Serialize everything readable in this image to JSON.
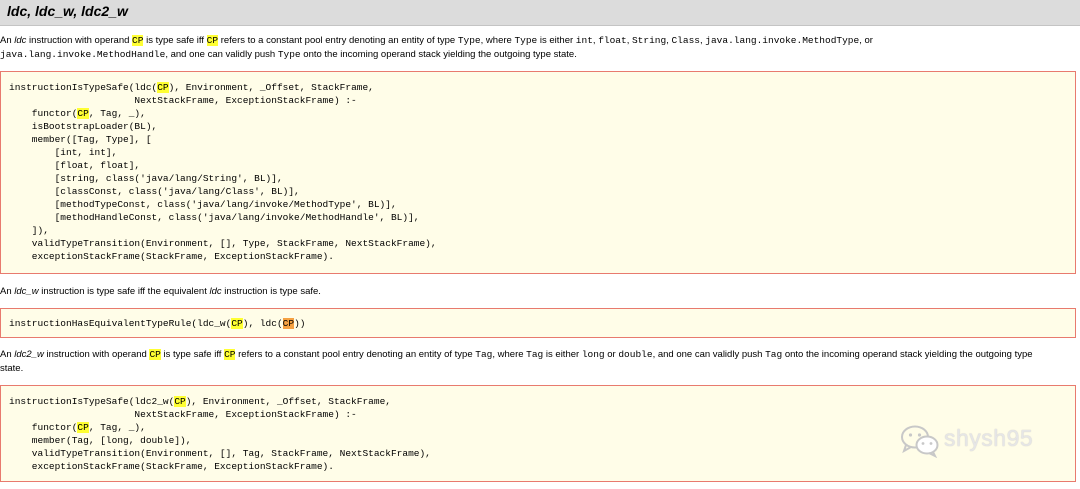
{
  "section": {
    "title": "ldc, ldc_w, ldc2_w"
  },
  "para1": {
    "t1": "An ",
    "ldc": "ldc",
    "t2": " instruction with operand ",
    "cp1": "CP",
    "t3": " is type safe iff ",
    "cp2": "CP",
    "t4": " refers to a constant pool entry denoting an entity of type ",
    "c_type": "Type",
    "t5": ", where ",
    "c_type2": "Type",
    "t6": " is either ",
    "c_int": "int",
    "t7": ", ",
    "c_float": "float",
    "t8": ", ",
    "c_string": "String",
    "t9": ", ",
    "c_class": "Class",
    "t10": ", ",
    "c_mt": "java.lang.invoke.MethodType",
    "t11": ", or",
    "c_mh": "java.lang.invoke.MethodHandle",
    "t12": ", and one can validly push ",
    "c_type3": "Type",
    "t13": " onto the incoming operand stack yielding the outgoing type state."
  },
  "code1": {
    "l1a": "instructionIsTypeSafe(ldc(",
    "l1cp": "CP",
    "l1b": "), Environment, _Offset, StackFrame,",
    "l2": "                      NextStackFrame, ExceptionStackFrame) :-",
    "l3a": "    functor(",
    "l3cp": "CP",
    "l3b": ", Tag, _),",
    "l4": "    isBootstrapLoader(BL),",
    "l5": "    member([Tag, Type], [",
    "l6": "        [int, int],",
    "l7": "        [float, float],",
    "l8": "        [string, class('java/lang/String', BL)],",
    "l9": "        [classConst, class('java/lang/Class', BL)],",
    "l10": "        [methodTypeConst, class('java/lang/invoke/MethodType', BL)],",
    "l11": "        [methodHandleConst, class('java/lang/invoke/MethodHandle', BL)],",
    "l12": "    ]),",
    "l13": "    validTypeTransition(Environment, [], Type, StackFrame, NextStackFrame),",
    "l14": "    exceptionStackFrame(StackFrame, ExceptionStackFrame)."
  },
  "para2": {
    "t1": "An ",
    "ldcw": "ldc_w",
    "t2": " instruction is type safe iff the equivalent ",
    "ldc": "ldc",
    "t3": " instruction is type safe."
  },
  "code2": {
    "a": "instructionHasEquivalentTypeRule(ldc_w(",
    "cp1": "CP",
    "b": "), ldc(",
    "cp2": "CP",
    "c": "))"
  },
  "para3": {
    "t1": "An ",
    "ldc2w": "ldc2_w",
    "t2": " instruction with operand ",
    "cp1": "CP",
    "t3": " is type safe iff ",
    "cp2": "CP",
    "t4": " refers to a constant pool entry denoting an entity of type ",
    "c_tag": "Tag",
    "t5": ", where ",
    "c_tag2": "Tag",
    "t6": " is either ",
    "c_long": "long",
    "t7": " or ",
    "c_double": "double",
    "t8": ", and one can validly push ",
    "c_tag3": "Tag",
    "t9": " onto the incoming operand stack yielding the outgoing type",
    "t10": "state."
  },
  "code3": {
    "l1a": "instructionIsTypeSafe(ldc2_w(",
    "l1cp": "CP",
    "l1b": "), Environment, _Offset, StackFrame,",
    "l2": "                      NextStackFrame, ExceptionStackFrame) :-",
    "l3a": "    functor(",
    "l3cp": "CP",
    "l3b": ", Tag, _),",
    "l4": "    member(Tag, [long, double]),",
    "l5": "    validTypeTransition(Environment, [], Tag, StackFrame, NextStackFrame),",
    "l6": "    exceptionStackFrame(StackFrame, ExceptionStackFrame)."
  },
  "watermark": {
    "text": "shysh95",
    "icon": "wechat-icon"
  }
}
